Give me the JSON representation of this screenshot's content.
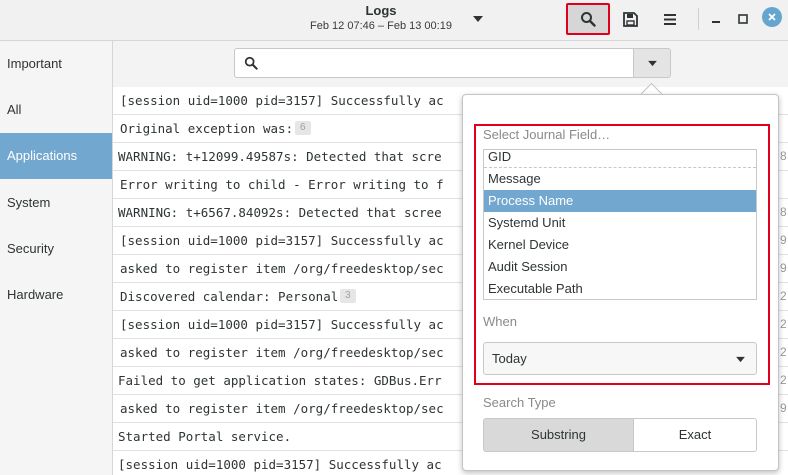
{
  "header": {
    "title": "Logs",
    "subtitle": "Feb 12 07:46 – Feb 13 00:19"
  },
  "icons": {
    "range": "chevron-down-icon",
    "search": "search-icon",
    "save": "save-icon",
    "menu": "hamburger-menu-icon",
    "minimize": "minimize-icon",
    "maximize": "maximize-icon",
    "close": "close-icon"
  },
  "colors": {
    "accent": "#72a7cf",
    "highlight_border": "#e0001b",
    "close_button": "#65a6cf"
  },
  "sidebar": {
    "items": [
      {
        "label": "Important",
        "active": false
      },
      {
        "label": "All",
        "active": false
      },
      {
        "label": "Applications",
        "active": true
      },
      {
        "label": "System",
        "active": false
      },
      {
        "label": "Security",
        "active": false
      },
      {
        "label": "Hardware",
        "active": false
      }
    ]
  },
  "search": {
    "value": "",
    "placeholder": ""
  },
  "logs": [
    {
      "text": "[session uid=1000 pid=3157] Successfully ac",
      "badge": "",
      "right": ""
    },
    {
      "text": "Original exception was:",
      "badge": "6",
      "right": ""
    },
    {
      "text": "WARNING: t+12099.49587s: Detected that scre",
      "badge": "",
      "right": "8"
    },
    {
      "text": "Error writing to child - Error writing to f",
      "badge": "",
      "right": ""
    },
    {
      "text": "WARNING: t+6567.84092s: Detected that scree",
      "badge": "",
      "right": "8"
    },
    {
      "text": "[session uid=1000 pid=3157] Successfully ac",
      "badge": "",
      "right": "9"
    },
    {
      "text": "asked to register item /org/freedesktop/sec",
      "badge": "",
      "right": "9"
    },
    {
      "text": "Discovered calendar:  Personal",
      "badge": "3",
      "right": "2"
    },
    {
      "text": "[session uid=1000 pid=3157] Successfully ac",
      "badge": "",
      "right": "2"
    },
    {
      "text": "asked to register item /org/freedesktop/sec",
      "badge": "",
      "right": "2"
    },
    {
      "text": "Failed to get application states: GDBus.Err",
      "badge": "",
      "right": "2"
    },
    {
      "text": "asked to register item /org/freedesktop/sec",
      "badge": "",
      "right": "9"
    },
    {
      "text": "Started Portal service.",
      "badge": "",
      "right": ""
    },
    {
      "text": "[session uid=1000 pid=3157] Successfully ac",
      "badge": "",
      "right": ""
    }
  ],
  "popover": {
    "field_label": "Select Journal Field…",
    "fields": [
      {
        "label": "GID",
        "selected": false
      },
      {
        "label": "Message",
        "selected": false
      },
      {
        "label": "Process Name",
        "selected": true
      },
      {
        "label": "Systemd Unit",
        "selected": false
      },
      {
        "label": "Kernel Device",
        "selected": false
      },
      {
        "label": "Audit Session",
        "selected": false
      },
      {
        "label": "Executable Path",
        "selected": false
      }
    ],
    "when_label": "When",
    "when_value": "Today",
    "search_type_label": "Search Type",
    "search_types": [
      {
        "label": "Substring",
        "active": true
      },
      {
        "label": "Exact",
        "active": false
      }
    ]
  }
}
